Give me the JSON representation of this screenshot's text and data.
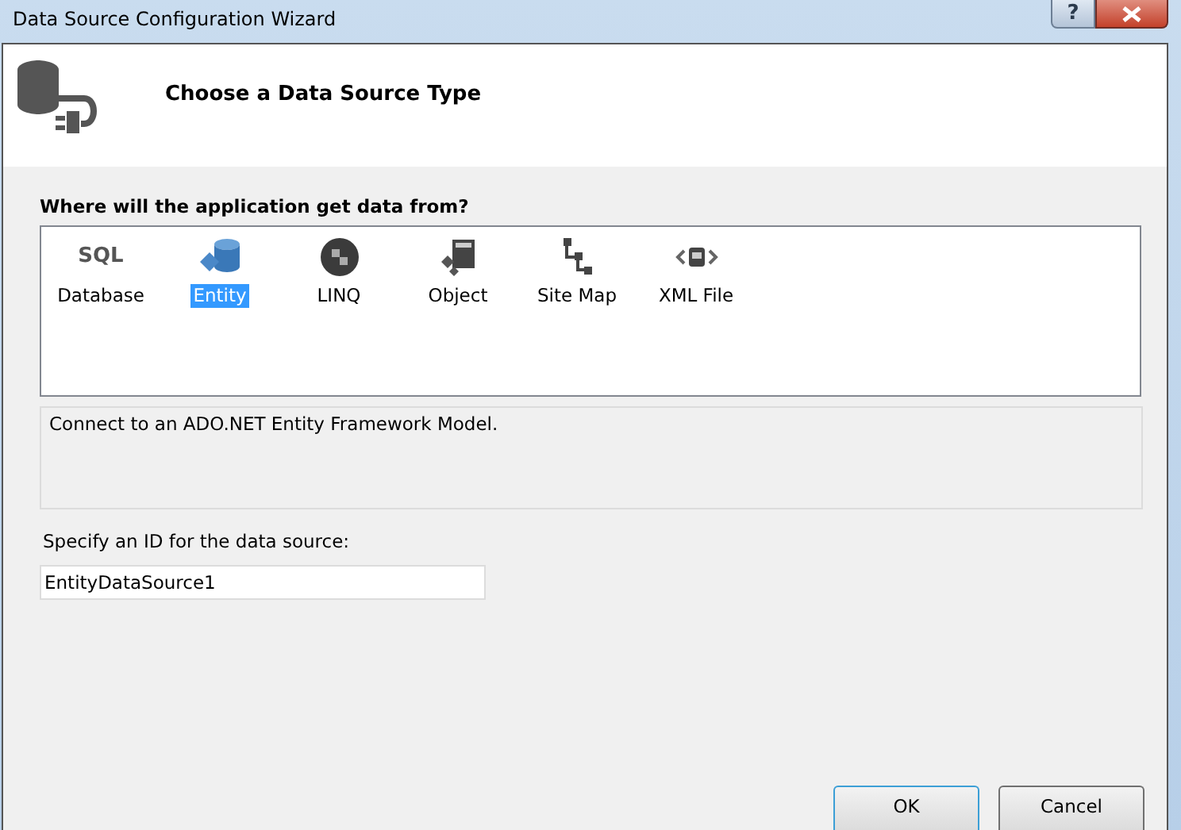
{
  "window": {
    "title": "Data Source Configuration Wizard",
    "help_button": "?"
  },
  "header": {
    "title": "Choose a Data Source Type"
  },
  "prompt": "Where will the application get data from?",
  "sources": [
    {
      "label": "Database",
      "kind": "sql",
      "icon_text": "SQL",
      "selected": false
    },
    {
      "label": "Entity",
      "kind": "entity",
      "selected": true
    },
    {
      "label": "LINQ",
      "kind": "linq",
      "selected": false
    },
    {
      "label": "Object",
      "kind": "object",
      "selected": false
    },
    {
      "label": "Site Map",
      "kind": "sitemap",
      "selected": false
    },
    {
      "label": "XML File",
      "kind": "xml",
      "selected": false
    }
  ],
  "description": "Connect to an ADO.NET Entity Framework Model.",
  "id_field": {
    "label": "Specify an ID for the data source:",
    "value": "EntityDataSource1"
  },
  "buttons": [
    "OK",
    "Cancel"
  ]
}
